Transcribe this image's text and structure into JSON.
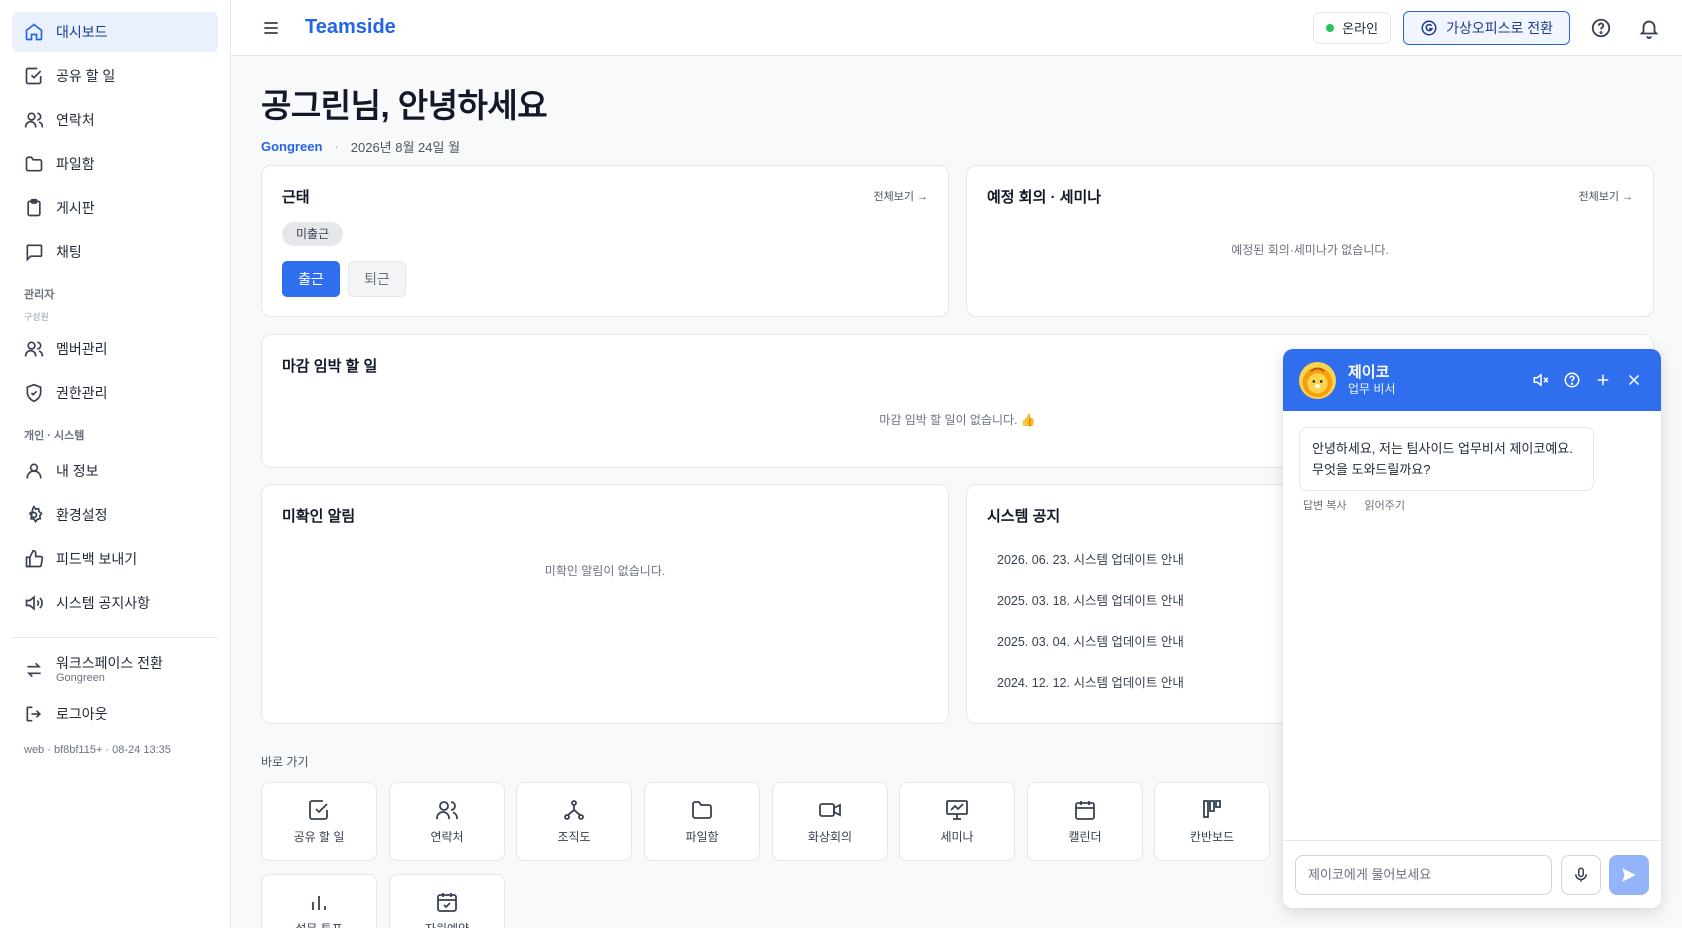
{
  "sidebar": {
    "items": [
      {
        "label": "대시보드",
        "icon": "home-icon",
        "active": true
      },
      {
        "label": "공유 할 일",
        "icon": "checkbox-icon"
      },
      {
        "label": "연락처",
        "icon": "users-icon"
      },
      {
        "label": "파일함",
        "icon": "folder-icon"
      },
      {
        "label": "게시판",
        "icon": "clipboard-icon"
      },
      {
        "label": "채팅",
        "icon": "chat-icon"
      }
    ],
    "admin_section": "관리자",
    "admin_sub": "구성원",
    "admin_items": [
      {
        "label": "멤버관리",
        "icon": "users-icon"
      },
      {
        "label": "권한관리",
        "icon": "shield-icon"
      }
    ],
    "personal_section": "개인 · 시스템",
    "personal_items": [
      {
        "label": "내 정보",
        "icon": "user-icon"
      },
      {
        "label": "환경설정",
        "icon": "gear-icon"
      },
      {
        "label": "피드백 보내기",
        "icon": "thumbs-up-icon"
      },
      {
        "label": "시스템 공지사항",
        "icon": "speaker-icon"
      }
    ],
    "workspace_switch": {
      "label": "워크스페이스 전환",
      "sub": "Gongreen"
    },
    "logout": "로그아웃",
    "version": "web · bf8bf115+ · 08-24 13:35"
  },
  "header": {
    "brand": "Teamside",
    "status": "온라인",
    "switch_button": "가상오피스로 전환",
    "status_color": "#22c55e",
    "accent": "#2563eb"
  },
  "main": {
    "greeting": "공그린님, 안녕하세요",
    "org": "Gongreen",
    "separator": "·",
    "date": "2026년 8월 24일 월",
    "attendance": {
      "title": "근태",
      "link": "전체보기 →",
      "status": "미출근",
      "check_in": "출근",
      "check_out": "퇴근"
    },
    "meetings": {
      "title": "예정 회의 · 세미나",
      "link": "전체보기 →",
      "empty": "예정된 회의·세미나가 없습니다."
    },
    "deadline": {
      "title": "마감 임박 할 일",
      "empty": "마감 임박 할 일이 없습니다. 👍"
    },
    "unread": {
      "title": "미확인 알림",
      "empty": "미확인 알림이 없습니다."
    },
    "notices": {
      "title": "시스템 공지",
      "items": [
        "2026. 06. 23. 시스템 업데이트 안내",
        "2025. 03. 18. 시스템 업데이트 안내",
        "2025. 03. 04. 시스템 업데이트 안내",
        "2024. 12. 12. 시스템 업데이트 안내"
      ]
    },
    "quick_label": "바로 가기",
    "quick": [
      {
        "label": "공유 할 일",
        "icon": "checkbox-icon"
      },
      {
        "label": "연락처",
        "icon": "users-icon"
      },
      {
        "label": "조직도",
        "icon": "org-chart-icon"
      },
      {
        "label": "파일함",
        "icon": "folder-icon"
      },
      {
        "label": "화상회의",
        "icon": "video-icon"
      },
      {
        "label": "세미나",
        "icon": "presentation-icon"
      },
      {
        "label": "캘린더",
        "icon": "calendar-icon"
      },
      {
        "label": "칸반보드",
        "icon": "kanban-icon"
      },
      {
        "label": "설문 투표",
        "icon": "bar-chart-icon"
      },
      {
        "label": "자원예약",
        "icon": "calendar-check-icon"
      }
    ]
  },
  "chat": {
    "name": "제이코",
    "role": "업무 비서",
    "message_line1": "안녕하세요, 저는 팀사이드 업무비서 제이코예요.",
    "message_line2": "무엇을 도와드릴까요?",
    "copy_action": "답변 복사",
    "read_action": "읽어주기",
    "input_placeholder": "제이코에게 물어보세요",
    "header_color": "#2f6fed"
  }
}
